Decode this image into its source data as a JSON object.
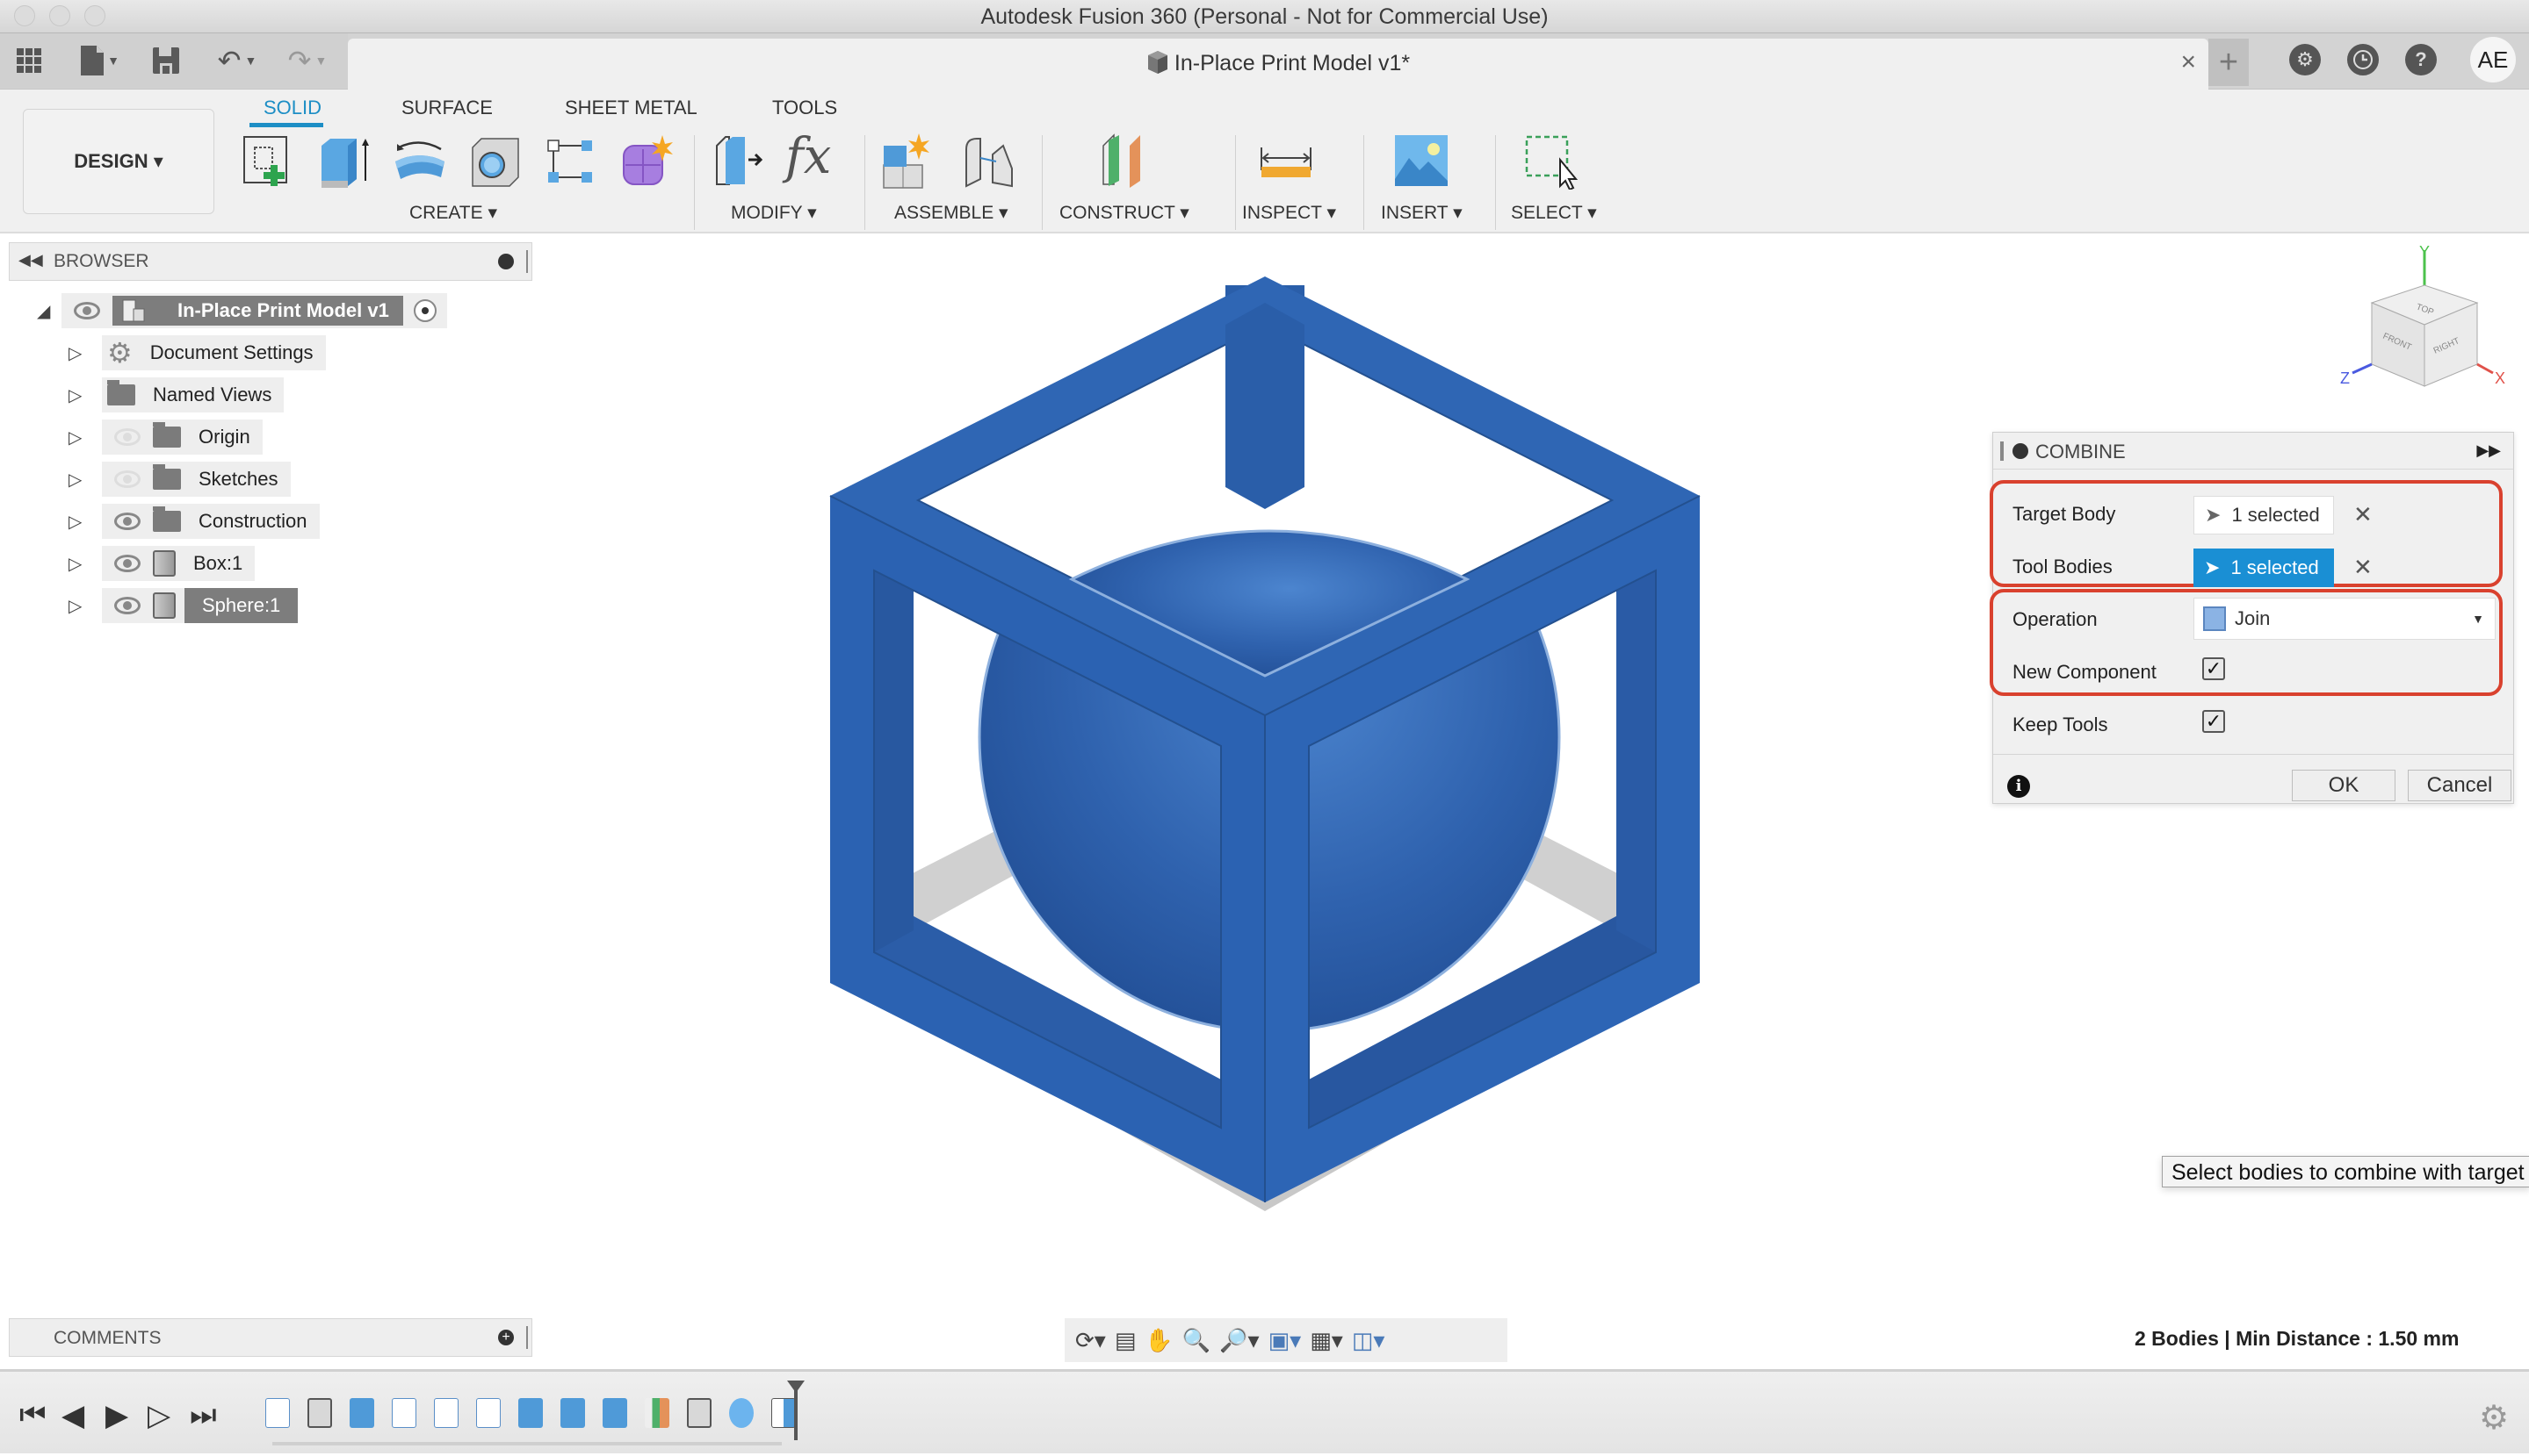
{
  "window": {
    "title": "Autodesk Fusion 360 (Personal - Not for Commercial Use)"
  },
  "quick_access": {
    "icons": [
      "app-grid-icon",
      "file-icon",
      "save-icon",
      "undo-icon",
      "redo-icon"
    ]
  },
  "document_tab": {
    "title": "In-Place Print Model v1*",
    "close": "×"
  },
  "top_right": {
    "new_tab": "+",
    "icons": [
      "extensions-icon",
      "job-status-icon",
      "help-icon"
    ],
    "avatar_initials": "AE"
  },
  "ribbon": {
    "workspace": "DESIGN ▾",
    "tabs": [
      {
        "label": "SOLID",
        "active": true
      },
      {
        "label": "SURFACE",
        "active": false
      },
      {
        "label": "SHEET METAL",
        "active": false
      },
      {
        "label": "TOOLS",
        "active": false
      }
    ],
    "groups": [
      {
        "label": "CREATE ▾",
        "tools": [
          "create-sketch",
          "extrude",
          "revolve",
          "hole",
          "pattern",
          "create-form"
        ]
      },
      {
        "label": "MODIFY ▾",
        "tools": [
          "press-pull",
          "parameters"
        ]
      },
      {
        "label": "ASSEMBLE ▾",
        "tools": [
          "new-component",
          "joint"
        ]
      },
      {
        "label": "CONSTRUCT ▾",
        "tools": [
          "offset-plane"
        ]
      },
      {
        "label": "INSPECT ▾",
        "tools": [
          "measure"
        ]
      },
      {
        "label": "INSERT ▾",
        "tools": [
          "insert-image"
        ]
      },
      {
        "label": "SELECT ▾",
        "tools": [
          "select"
        ]
      }
    ],
    "fx_label": "fx"
  },
  "browser": {
    "title": "BROWSER",
    "root": {
      "label": "In-Place Print Model v1"
    },
    "items": [
      {
        "label": "Document Settings",
        "icon": "gear",
        "visible": null
      },
      {
        "label": "Named Views",
        "icon": "folder",
        "visible": null
      },
      {
        "label": "Origin",
        "icon": "folder",
        "visible": false
      },
      {
        "label": "Sketches",
        "icon": "folder",
        "visible": false
      },
      {
        "label": "Construction",
        "icon": "folder",
        "visible": true
      },
      {
        "label": "Box:1",
        "icon": "component",
        "visible": true
      },
      {
        "label": "Sphere:1",
        "icon": "component",
        "visible": true,
        "highlighted": true
      }
    ]
  },
  "viewcube": {
    "faces": [
      "TOP",
      "FRONT",
      "RIGHT"
    ],
    "axes": [
      "Y",
      "Z",
      "X"
    ],
    "axis_colors": {
      "x": "#e0524a",
      "y": "#4cc24c",
      "z": "#4a5ae0"
    }
  },
  "model": {
    "body_color": "#2d62b0",
    "bodies": [
      "Box:1 (frame)",
      "Sphere:1"
    ]
  },
  "combine_dialog": {
    "title": "COMBINE",
    "target_body": {
      "label": "Target Body",
      "value": "1 selected",
      "active": false
    },
    "tool_bodies": {
      "label": "Tool Bodies",
      "value": "1 selected",
      "active": true
    },
    "operation": {
      "label": "Operation",
      "value": "Join"
    },
    "new_component": {
      "label": "New Component",
      "checked": true
    },
    "keep_tools": {
      "label": "Keep Tools",
      "checked": true
    },
    "ok": "OK",
    "cancel": "Cancel",
    "check_glyph": "✓",
    "clear_glyph": "✕",
    "highlight_color": "#d9412e",
    "active_color": "#1a8fd4"
  },
  "tooltip": {
    "text": "Select bodies to combine with target body"
  },
  "comments": {
    "title": "COMMENTS"
  },
  "navbar": {
    "icons": [
      "orbit-icon",
      "look-at-icon",
      "pan-icon",
      "zoom-icon",
      "fit-icon",
      "display-settings-icon",
      "grid-icon",
      "viewports-icon"
    ]
  },
  "status": {
    "text": "2 Bodies | Min Distance : 1.50 mm"
  },
  "timeline": {
    "controls": [
      "first",
      "previous",
      "play",
      "next",
      "last"
    ],
    "features": [
      "sketch",
      "box",
      "extrude",
      "sketch",
      "sketch",
      "sketch",
      "extrude",
      "extrude",
      "extrude",
      "offset-plane",
      "box",
      "sphere",
      "combine"
    ]
  }
}
